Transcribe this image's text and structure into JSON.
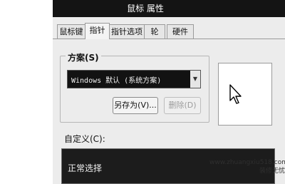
{
  "window": {
    "title": "鼠标 属性"
  },
  "tabs": [
    {
      "label": "鼠标键"
    },
    {
      "label": "指针"
    },
    {
      "label": "指针选项"
    },
    {
      "label": "轮"
    },
    {
      "label": "硬件"
    }
  ],
  "active_tab": "指针",
  "scheme": {
    "group_label": "方案(S)",
    "selected": "Windows 默认 (系统方案)",
    "save_as_label": "另存为(V)...",
    "delete_label": "删除(D)"
  },
  "custom": {
    "label": "自定义(C):",
    "items": [
      {
        "label": "正常选择"
      }
    ]
  },
  "watermark": {
    "url": "www.zhuangxiu518.com",
    "text": "装修无忧"
  },
  "icons": {
    "preview": "arrow-pointer-icon",
    "dropdown": "chevron-down-icon"
  },
  "colors": {
    "titlebar": "#141414",
    "dialog": "#ececec",
    "dark_field": "#121212"
  }
}
